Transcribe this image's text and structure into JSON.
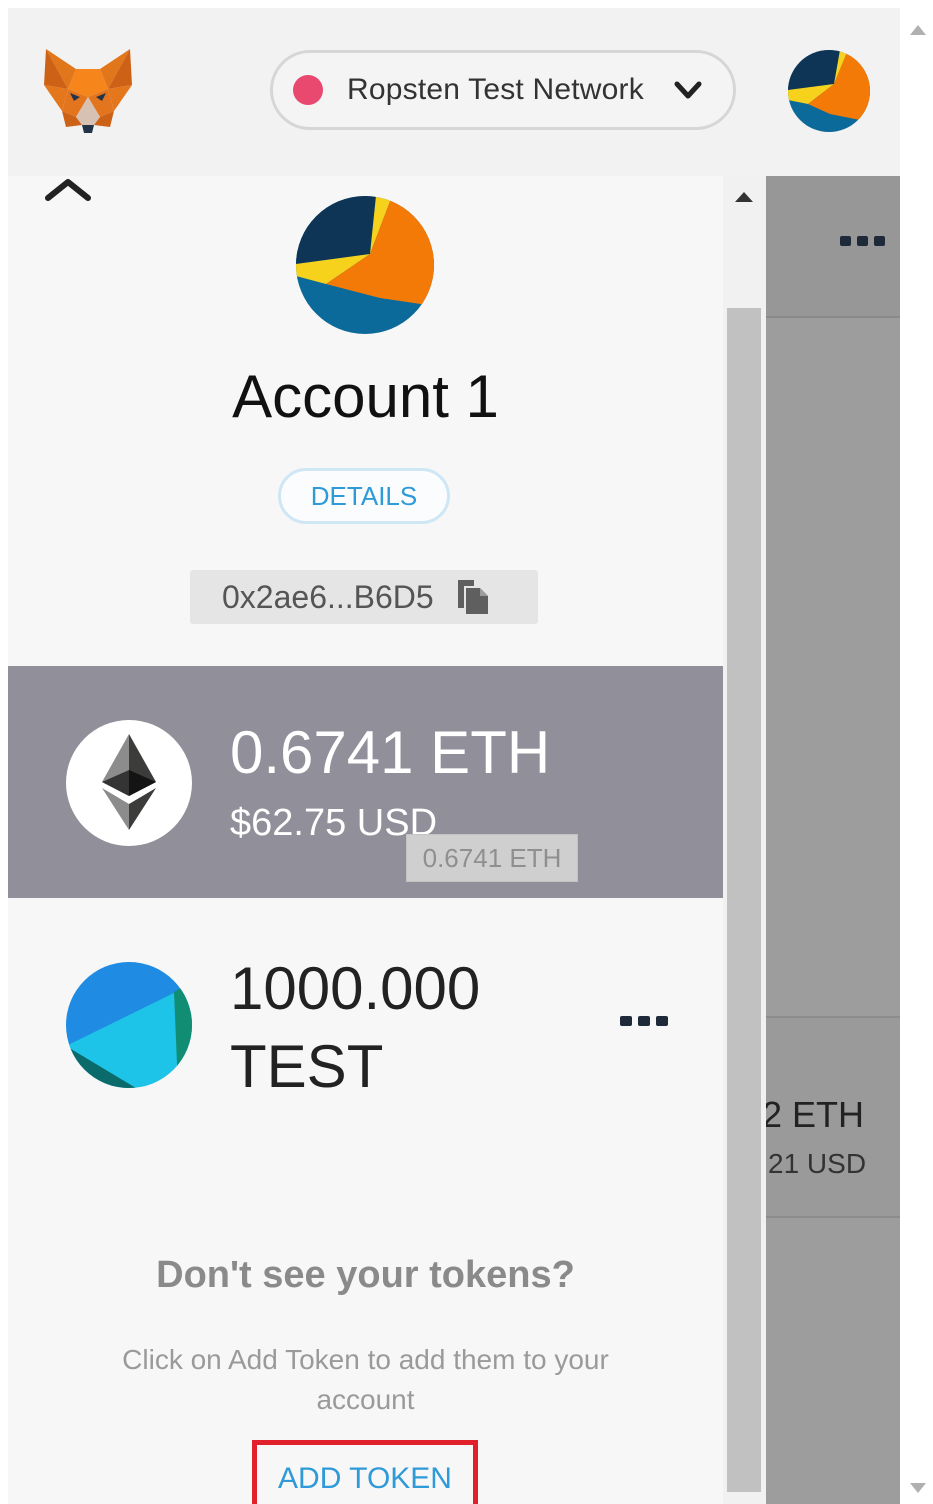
{
  "header": {
    "network_name": "Ropsten Test Network",
    "network_status_color": "#e9496f"
  },
  "account": {
    "name": "Account 1",
    "details_label": "DETAILS",
    "address": "0x2ae6...B6D5"
  },
  "eth_balance": {
    "amount": "0.6741 ETH",
    "usd": "$62.75 USD",
    "tooltip": "0.6741 ETH"
  },
  "token": {
    "amount": "1000.000",
    "symbol": "TEST"
  },
  "empty_state": {
    "title": "Don't see your tokens?",
    "description": "Click on Add Token to add them to your account",
    "add_token_label": "ADD TOKEN"
  },
  "background_view": {
    "eth_partial": "2 ETH",
    "usd_partial": "21 USD"
  },
  "colors": {
    "accent_blue": "#2e9ad8",
    "highlight_red": "#e0202a",
    "selected_row": "#918f99"
  },
  "icons": [
    "metamask-fox-icon",
    "chevron-down-icon",
    "chevron-up-icon",
    "copy-icon",
    "ethereum-icon",
    "more-dots-icon"
  ]
}
